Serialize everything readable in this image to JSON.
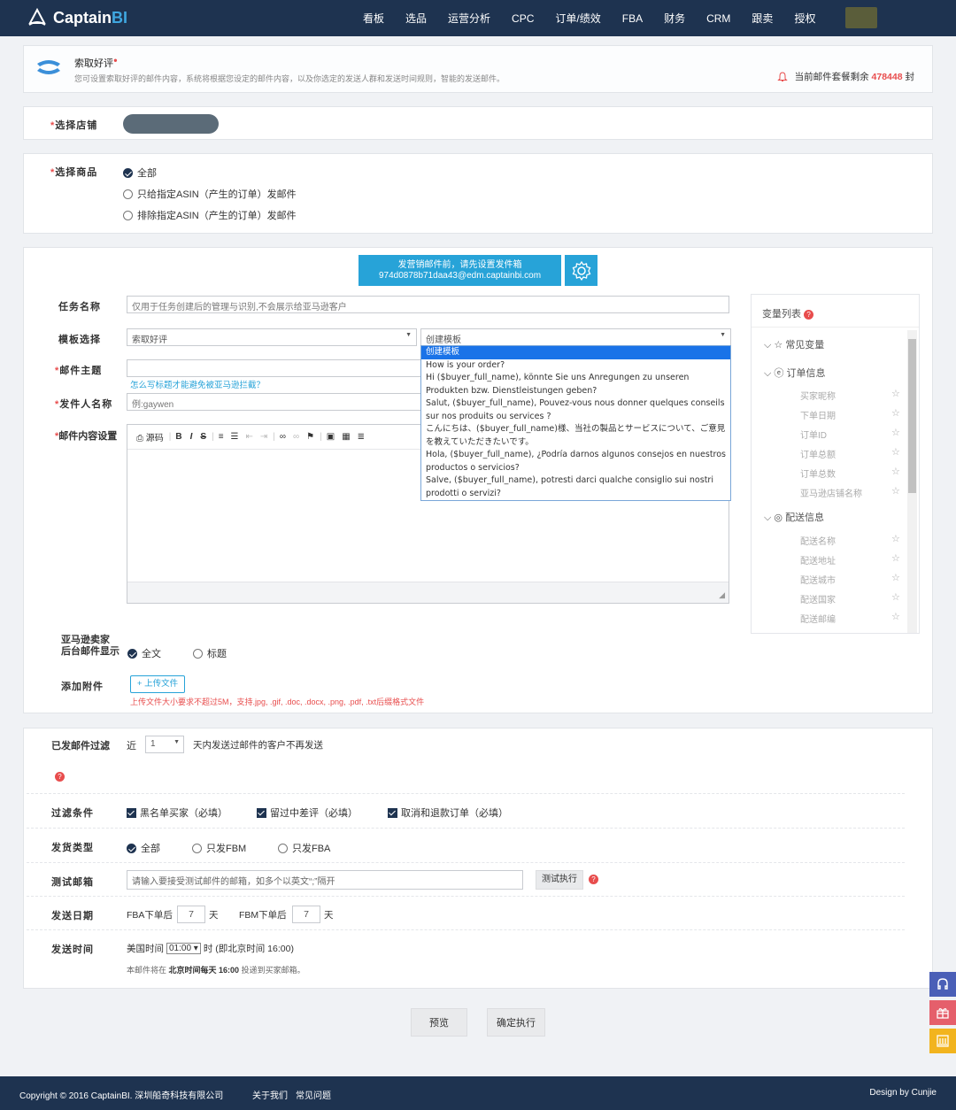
{
  "app": {
    "brand_main": "Captain",
    "brand_accent": "BI"
  },
  "nav": [
    "看板",
    "选品",
    "运营分析",
    "CPC",
    "订单/绩效",
    "FBA",
    "财务",
    "CRM",
    "跟卖",
    "授权"
  ],
  "header": {
    "title": "索取好评",
    "description": "您可设置索取好评的邮件内容，系统将根据您设定的邮件内容，以及你选定的发送人群和发送时间规则，智能的发送邮件。",
    "quota_label": "当前邮件套餐剩余",
    "quota_value": "478448",
    "quota_unit": "封"
  },
  "store": {
    "label": "选择店铺"
  },
  "product": {
    "label": "选择商品",
    "options": [
      "全部",
      "只给指定ASIN（产生的订单）发邮件",
      "排除指定ASIN（产生的订单）发邮件"
    ]
  },
  "notice": {
    "line1": "发营销邮件前，请先设置发件箱",
    "line2": "974d0878b71daa43@edm.captainbi.com"
  },
  "form": {
    "task_label": "任务名称",
    "task_placeholder": "仅用于任务创建后的管理与识别,不会展示给亚马逊客户",
    "template_label": "模板选择",
    "template_value": "索取好评",
    "template2_value": "创建模板",
    "subject_label": "邮件主题",
    "subject_hint": "怎么写标题才能避免被亚马逊拦截？",
    "sender_label": "发件人名称",
    "sender_placeholder": "例:gaywen",
    "content_label": "邮件内容设置",
    "toolbar_source": "源码",
    "display_label_1": "亚马逊卖家",
    "display_label_2": "后台邮件显示",
    "display_options": [
      "全文",
      "标题"
    ],
    "attach_label": "添加附件",
    "upload_button": "+ 上传文件",
    "upload_hint": "上传文件大小要求不超过5M，支持.jpg, .gif, .doc, .docx, .png, .pdf, .txt后缀格式文件"
  },
  "template_dropdown": [
    "创建模板",
    "How is your order?",
    "Hi ($buyer_full_name), könnte Sie uns Anregungen zu unseren Produkten bzw. Dienstleistungen geben?",
    "Salut, ($buyer_full_name), Pouvez-vous nous donner quelques conseils sur nos produits ou services ?",
    "こんにちは、($buyer_full_name)様、当社の製品とサービスについて、ご意見を教えていただきたいです。",
    "Hola, ($buyer_full_name), ¿Podría darnos algunos consejos en nuestros productos o servicios?",
    "Salve, ($buyer_full_name), potresti darci qualche consiglio sui nostri prodotti o servizi?"
  ],
  "variables": {
    "title": "变量列表",
    "groups": [
      {
        "name": "常见变量",
        "items": []
      },
      {
        "name": "订单信息",
        "items": [
          "买家昵称",
          "下单日期",
          "订单ID",
          "订单总额",
          "订单总数",
          "亚马逊店铺名称"
        ]
      },
      {
        "name": "配送信息",
        "items": [
          "配送名称",
          "配送地址",
          "配送城市",
          "配送国家",
          "配送邮编"
        ]
      }
    ]
  },
  "settings": {
    "filter_label": "已发邮件过滤",
    "filter_prefix": "近",
    "filter_days": "1",
    "filter_suffix": "天内发送过邮件的客户不再发送",
    "cond_label": "过滤条件",
    "conditions": [
      "黑名单买家（必填）",
      "留过中差评（必填）",
      "取消和退款订单（必填）"
    ],
    "ship_label": "发货类型",
    "ship_options": [
      "全部",
      "只发FBM",
      "只发FBA"
    ],
    "test_label": "测试邮箱",
    "test_placeholder": "请输入要接受测试邮件的邮箱，如多个以英文“;”隔开",
    "test_button": "测试执行",
    "date_label": "发送日期",
    "fba_prefix": "FBA下单后",
    "fba_days": "7",
    "fbm_prefix": "FBM下单后",
    "fbm_days": "7",
    "day_unit": "天",
    "time_label": "发送时间",
    "time_prefix": "美国时间",
    "time_value": "01:00",
    "time_suffix": "时 (即北京时间 16:00)",
    "time_note_prefix": "本邮件将在",
    "time_note_bold": "北京时间每天 16:00",
    "time_note_suffix": "投递到买家邮箱。"
  },
  "actions": {
    "preview": "预览",
    "execute": "确定执行"
  },
  "footer": {
    "copyright": "Copyright © 2016 CaptainBI. 深圳船奇科技有限公司",
    "about": "关于我们",
    "faq": "常见问题",
    "design": "Design by Cunjie"
  },
  "colors": {
    "nav_bg": "#1e3350",
    "accent": "#27a3d8",
    "danger": "#e84d4d",
    "selected": "#1a73e8"
  }
}
